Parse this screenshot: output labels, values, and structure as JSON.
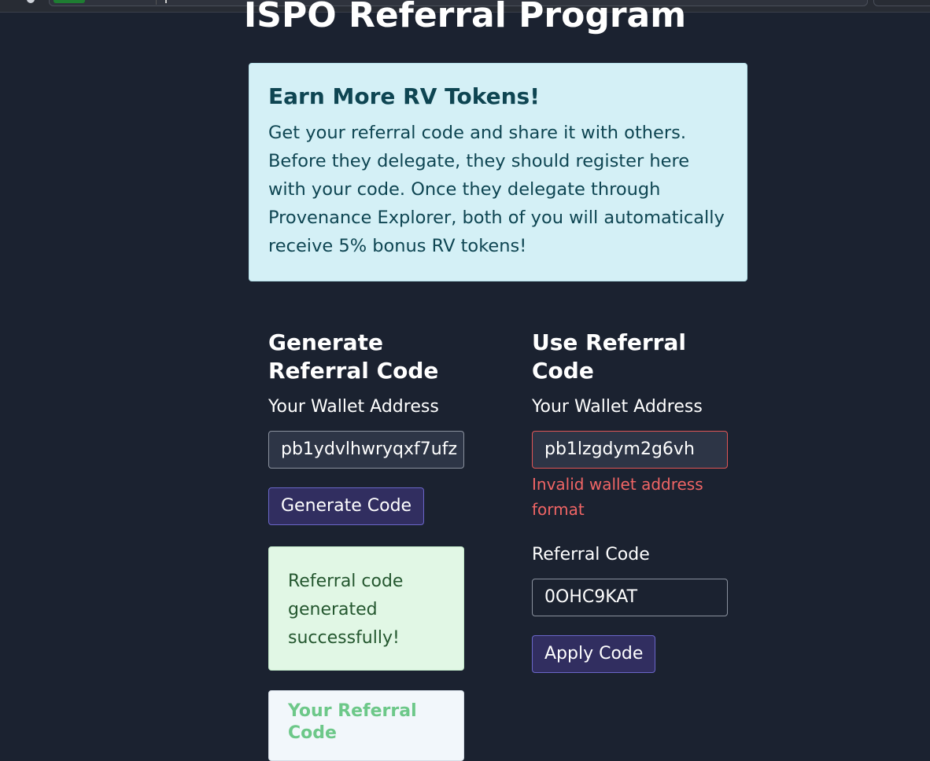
{
  "page": {
    "title": "ISPO Referral Program"
  },
  "info": {
    "heading": "Earn More RV Tokens!",
    "body": "Get your referral code and share it with others. Before they delegate, they should register here with your code. Once they delegate through Provenance Explorer, both of you will automatically receive 5% bonus RV tokens!"
  },
  "generate": {
    "heading": "Generate Referral Code",
    "wallet_label": "Your Wallet Address",
    "wallet_value": "pb1ydvlhwryqxf7ufz",
    "button_label": "Generate Code",
    "success_message": "Referral code generated successfully!",
    "code_card_title": "Your Referral Code"
  },
  "use": {
    "heading": "Use Referral Code",
    "wallet_label": "Your Wallet Address",
    "wallet_value": "pb1lzgdym2g6vh",
    "error_message": "Invalid wallet address format",
    "code_label": "Referral Code",
    "code_value": "0OHC9KAT",
    "button_label": "Apply Code"
  },
  "colors": {
    "background": "#1b2230",
    "info_bg": "#d4f0f6",
    "success_bg": "#e1f7e5",
    "button_bg": "#312e60",
    "error": "#f06565"
  }
}
